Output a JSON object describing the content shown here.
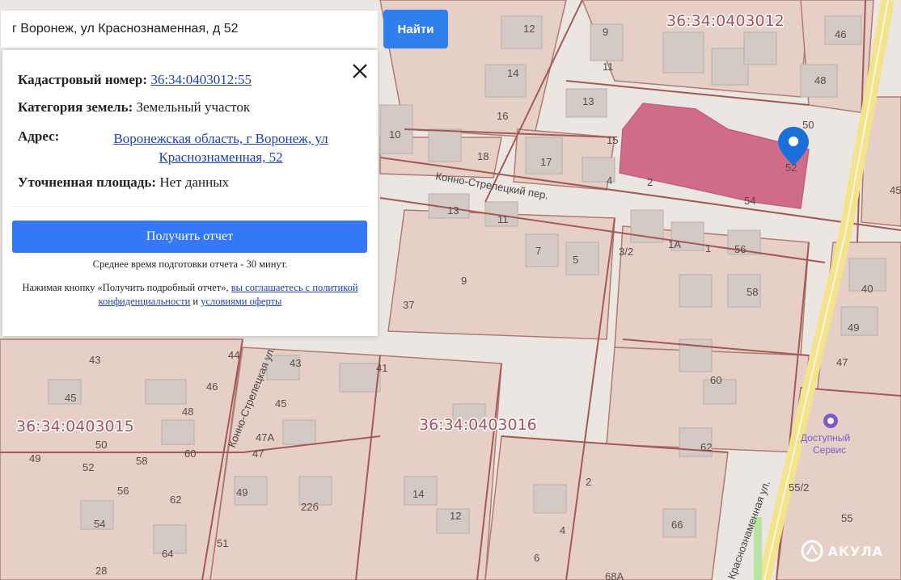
{
  "search": {
    "value": "г Воронеж, ул Краснознаменная, д 52",
    "button_label": "Найти"
  },
  "popup": {
    "cadastral_label": "Кадастровый номер:",
    "cadastral_value": "36:34:0403012:55",
    "category_label": "Категория земель:",
    "category_value": "Земельный участок",
    "address_label": "Адрес:",
    "address_line1": "Воронежская область, г Воронеж, ул",
    "address_line2": "Краснознаменная, 52",
    "area_label": "Уточненная площадь:",
    "area_value": "Нет данных",
    "report_button": "Получить отчет",
    "avg_time": "Среднее время подготовки отчета - 30 минут.",
    "legal_prefix": "Нажимая кнопку «Получить подробный отчет»,",
    "legal_link1": "вы соглашаетесь с политикой конфиденциальности",
    "legal_and": "и",
    "legal_link2": "условиями оферты"
  },
  "map": {
    "cadastral_quarters": [
      "36:34:0403012",
      "36:34:0403015",
      "36:34:0403016"
    ],
    "streets": [
      "Конно-Стрелецкий пер.",
      "Конно-Стрелецкая ул.",
      "Краснознаменная ул."
    ],
    "poi": "Доступный Сервис",
    "house_numbers": [
      "12",
      "9",
      "46",
      "14",
      "11",
      "48",
      "13",
      "16",
      "50",
      "10",
      "18",
      "17",
      "15",
      "52",
      "2",
      "54",
      "4",
      "45",
      "13",
      "11",
      "7",
      "5",
      "3/2",
      "1А",
      "1",
      "56",
      "9",
      "40",
      "37",
      "58",
      "49",
      "47",
      "41",
      "43",
      "44",
      "43",
      "46",
      "60",
      "45",
      "48",
      "45",
      "36:34:0403016",
      "50",
      "47А",
      "62",
      "49",
      "52",
      "58",
      "60",
      "47",
      "56",
      "62",
      "14",
      "2",
      "55/2",
      "12",
      "22б",
      "49",
      "55",
      "54",
      "66",
      "51",
      "4",
      "64",
      "6",
      "28",
      "68А"
    ],
    "highlight_color": "#c7436a",
    "marker_color": "#1a6fd8"
  },
  "watermark": "АКУЛА"
}
